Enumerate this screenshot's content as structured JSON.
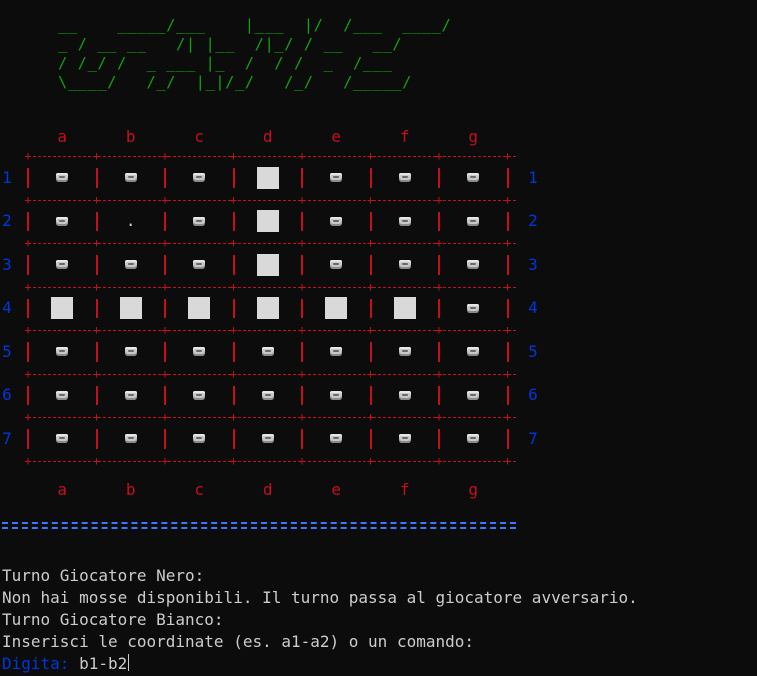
{
  "logo_ascii": "__    _____/___    |___  |/  /___  ____/\n_ / __ __   /| |__  /|_/ / __   __/\n/ /_/ /  _ ___ |_  /  / /  _  /___\n\\____/   /_/  |_|/_/   /_/   /_____/",
  "columns": [
    "a",
    "b",
    "c",
    "d",
    "e",
    "f",
    "g"
  ],
  "rows": [
    "1",
    "2",
    "3",
    "4",
    "5",
    "6",
    "7"
  ],
  "board": [
    [
      "piece",
      "piece",
      "piece",
      "empty",
      "piece",
      "piece",
      "piece"
    ],
    [
      "piece",
      "dot",
      "piece",
      "empty",
      "piece",
      "piece",
      "piece"
    ],
    [
      "piece",
      "piece",
      "piece",
      "empty",
      "piece",
      "piece",
      "piece"
    ],
    [
      "empty",
      "empty",
      "empty",
      "empty",
      "empty",
      "empty",
      "piece"
    ],
    [
      "piece",
      "piece",
      "piece",
      "piece",
      "piece",
      "piece",
      "piece"
    ],
    [
      "piece",
      "piece",
      "piece",
      "piece",
      "piece",
      "piece",
      "piece"
    ],
    [
      "piece",
      "piece",
      "piece",
      "piece",
      "piece",
      "piece",
      "piece"
    ]
  ],
  "cell_symbols": {
    "dot": "."
  },
  "icons": {
    "piece": "piece-icon",
    "empty": "empty-square"
  },
  "colors": {
    "logo": "#13a10e",
    "grid": "#c50f1f",
    "row_labels": "#0037da",
    "separator": "#3b78ff",
    "prompt": "#0037da",
    "text": "#cccccc",
    "background": "#0c0c0c"
  },
  "messages": {
    "line1": "Turno Giocatore Nero:",
    "line2": "Non hai mosse disponibili. Il turno passa al giocatore avversario.",
    "line3": "Turno Giocatore Bianco:",
    "line4": "Inserisci le coordinate (es. a1-a2) o un comando:"
  },
  "prompt": {
    "label": "Digita:",
    "value": "b1-b2"
  }
}
